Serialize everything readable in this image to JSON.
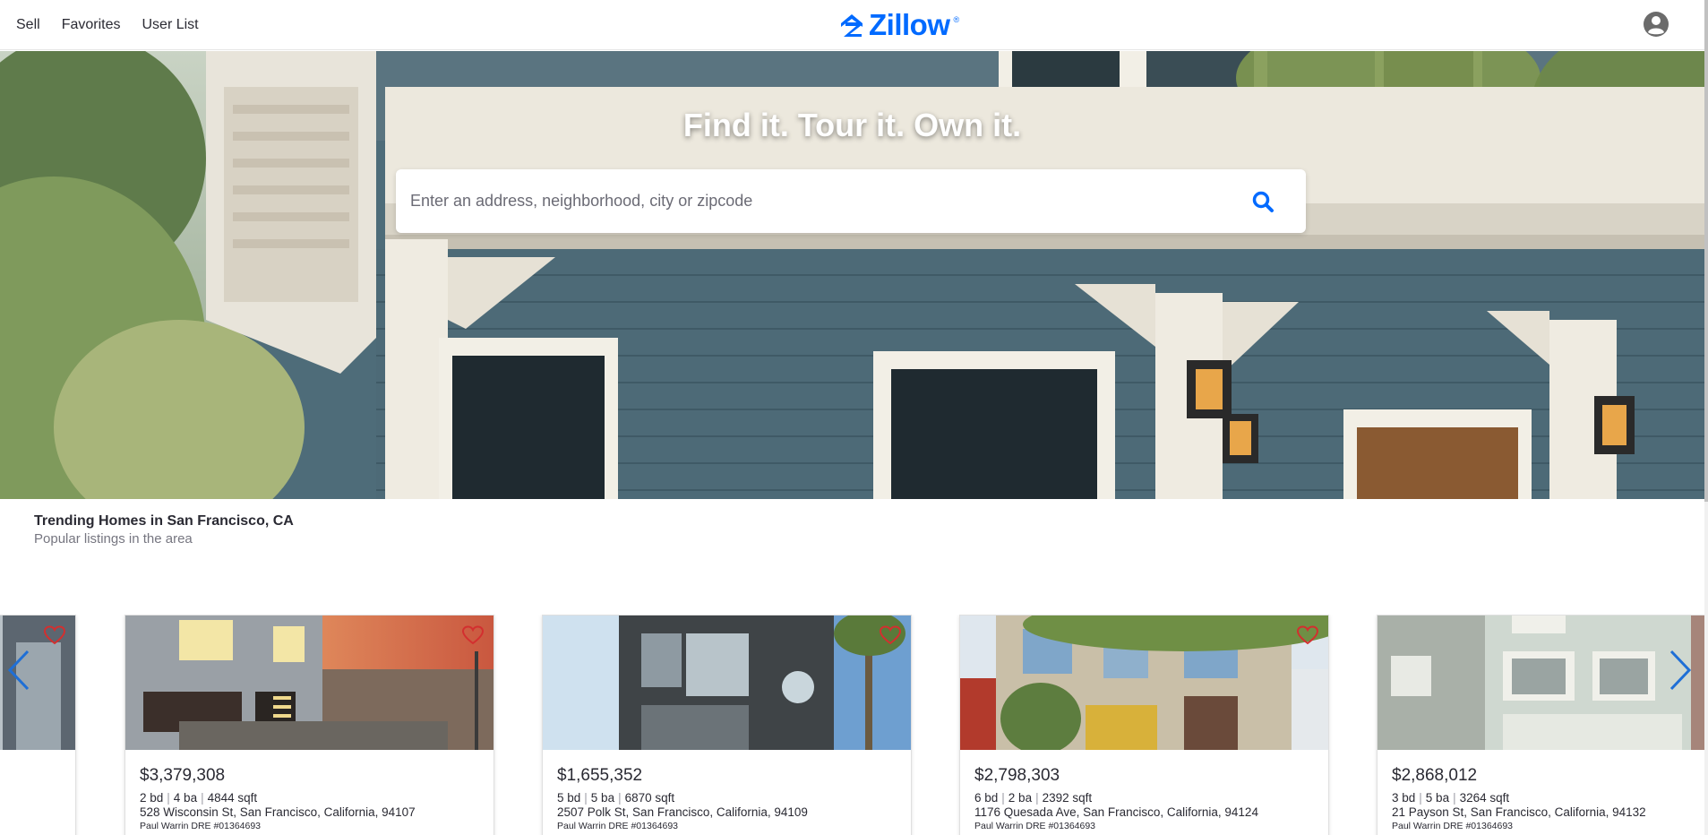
{
  "header": {
    "nav": [
      "Sell",
      "Favorites",
      "User List"
    ],
    "brand": "Zillow",
    "brand_mark": "®",
    "brand_color": "#006aff"
  },
  "hero": {
    "headline": "Find it. Tour it. Own it.",
    "search_placeholder": "Enter an address, neighborhood, city or zipcode"
  },
  "section": {
    "title": "Trending Homes in San Francisco, CA",
    "subtitle": "Popular listings in the area"
  },
  "listings": [
    {
      "price": "$3,379,308",
      "beds": "2 bd",
      "baths": "4 ba",
      "sqft": "4844 sqft",
      "address": "528 Wisconsin St, San Francisco, California, 94107",
      "agent": "Paul Warrin DRE #01364693"
    },
    {
      "price": "$1,655,352",
      "beds": "5 bd",
      "baths": "5 ba",
      "sqft": "6870 sqft",
      "address": "2507 Polk St, San Francisco, California, 94109",
      "agent": "Paul Warrin DRE #01364693"
    },
    {
      "price": "$2,798,303",
      "beds": "6 bd",
      "baths": "2 ba",
      "sqft": "2392 sqft",
      "address": "1176 Quesada Ave, San Francisco, California, 94124",
      "agent": "Paul Warrin DRE #01364693"
    },
    {
      "price": "$2,868,012",
      "beds": "3 bd",
      "baths": "5 ba",
      "sqft": "3264 sqft",
      "address": "21 Payson St, San Francisco, California, 94132",
      "agent": "Paul Warrin DRE #01364693"
    }
  ],
  "icons": {
    "search": "search-icon",
    "favorite": "heart-outline-icon",
    "profile": "user-circle-icon",
    "prev": "chevron-left-icon",
    "next": "chevron-right-icon"
  },
  "colors": {
    "accent": "#006aff",
    "favorite": "#d32f2f"
  }
}
